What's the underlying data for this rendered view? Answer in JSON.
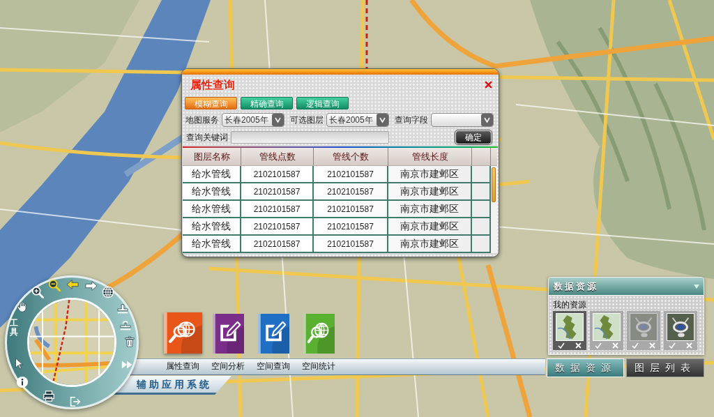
{
  "dialog": {
    "title": "属性查询",
    "tabs": [
      {
        "label": "模糊查询",
        "selected": true
      },
      {
        "label": "精确查询",
        "selected": false
      },
      {
        "label": "逻辑查询",
        "selected": false
      }
    ],
    "filters": [
      {
        "label": "地图服务",
        "value": "长春2005年"
      },
      {
        "label": "可选图层",
        "value": "长春2005年"
      },
      {
        "label": "查询字段"
      }
    ],
    "keyword": {
      "label": "查询关键词"
    },
    "submit_button": "确定",
    "table": {
      "columns": [
        "图层名称",
        "管线点数",
        "管线个数",
        "管线长度"
      ],
      "rows": [
        [
          "给水管线",
          "2102101587",
          "2102101587",
          "南京市建邺区"
        ],
        [
          "给水管线",
          "2102101587",
          "2102101587",
          "南京市建邺区"
        ],
        [
          "给水管线",
          "2102101587",
          "2102101587",
          "南京市建邺区"
        ],
        [
          "给水管线",
          "2102101587",
          "2102101587",
          "南京市建邺区"
        ],
        [
          "给水管线",
          "2102101587",
          "2102101587",
          "南京市建邺区"
        ]
      ]
    }
  },
  "tool_ring": {
    "label": "工具",
    "tools": [
      {
        "kind": "hand",
        "selected": false
      },
      {
        "kind": "zoom-in",
        "selected": false
      },
      {
        "kind": "zoom-out",
        "selected": true
      },
      {
        "kind": "arrow-left",
        "selected": true
      },
      {
        "kind": "arrow-right",
        "selected": false
      },
      {
        "kind": "globe",
        "selected": false
      },
      {
        "kind": "stamp",
        "selected": false
      },
      {
        "kind": "hook-stamp",
        "selected": false
      },
      {
        "kind": "trash",
        "selected": false
      },
      {
        "kind": "forward",
        "selected": false
      },
      {
        "kind": "exit",
        "selected": false
      },
      {
        "kind": "print",
        "selected": false
      },
      {
        "kind": "info",
        "selected": false
      },
      {
        "kind": "pointer",
        "selected": false
      }
    ]
  },
  "toolbar": {
    "items": [
      {
        "label": "属性查询",
        "kind": "search",
        "color": "#e8561a",
        "selected": true
      },
      {
        "label": "空间分析",
        "kind": "edit",
        "color": "#7b2d8a",
        "selected": false
      },
      {
        "label": "空间查询",
        "kind": "edit",
        "color": "#1f6fc4",
        "selected": false
      },
      {
        "label": "空间统计",
        "kind": "search",
        "color": "#5ab030",
        "selected": false
      }
    ]
  },
  "system_title": "辅助应用系统",
  "resource_panel": {
    "title": "数据资源",
    "section": "我的资源",
    "items": [
      {
        "kind": "map",
        "selected": true,
        "disabled": false
      },
      {
        "kind": "map",
        "selected": false,
        "disabled": false
      },
      {
        "kind": "satellite",
        "selected": false,
        "disabled": true
      },
      {
        "kind": "satellite",
        "selected": false,
        "disabled": false
      }
    ]
  },
  "bottom_tabs": [
    {
      "label": "数据资源",
      "selected": true
    },
    {
      "label": "图层列表",
      "selected": false
    }
  ]
}
